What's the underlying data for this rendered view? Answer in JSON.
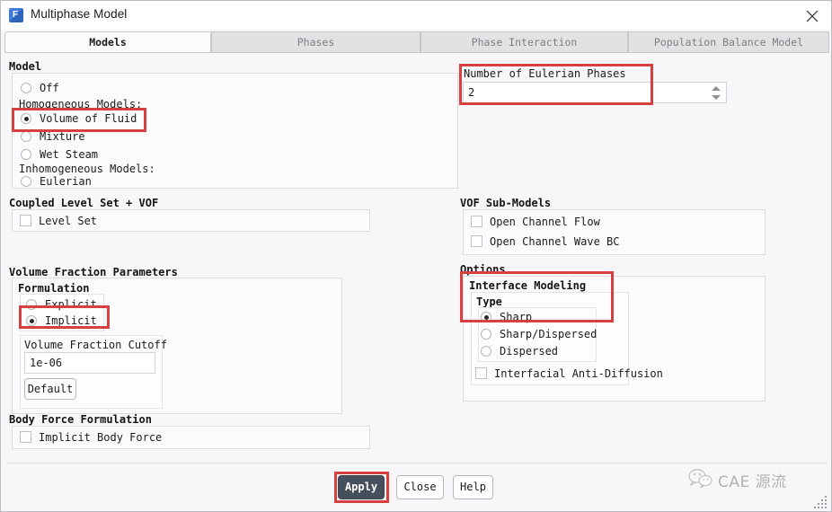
{
  "window": {
    "title": "Multiphase Model",
    "app_icon": "fluent-f-icon",
    "close_icon": "close-icon"
  },
  "tabs": [
    {
      "label": "Models",
      "active": true
    },
    {
      "label": "Phases",
      "active": false
    },
    {
      "label": "Phase Interaction",
      "active": false
    },
    {
      "label": "Population Balance Model",
      "active": false
    }
  ],
  "model_group": {
    "title": "Model",
    "off": "Off",
    "homogeneous_header": "Homogeneous Models:",
    "volume_of_fluid": "Volume of Fluid",
    "mixture": "Mixture",
    "wet_steam": "Wet Steam",
    "inhomogeneous_header": "Inhomogeneous Models:",
    "eulerian": "Eulerian",
    "selected": "Volume of Fluid"
  },
  "eulerian_phases": {
    "title": "Number of Eulerian Phases",
    "value": "2"
  },
  "level_set_group": {
    "title": "Coupled Level Set + VOF",
    "level_set": "Level Set",
    "level_set_checked": false
  },
  "vof_sub_models": {
    "title": "VOF Sub-Models",
    "open_channel_flow": "Open Channel Flow",
    "open_channel_flow_checked": false,
    "open_channel_wave_bc": "Open Channel Wave BC",
    "open_channel_wave_bc_checked": false
  },
  "volume_fraction": {
    "title": "Volume Fraction Parameters",
    "formulation_title": "Formulation",
    "explicit": "Explicit",
    "implicit": "Implicit",
    "selected": "Implicit",
    "cutoff_label": "Volume Fraction Cutoff",
    "cutoff_value": "1e-06",
    "default_button": "Default"
  },
  "options": {
    "title": "Options",
    "interface_modeling_title": "Interface Modeling",
    "type_title": "Type",
    "sharp": "Sharp",
    "sharp_dispersed": "Sharp/Dispersed",
    "dispersed": "Dispersed",
    "selected_type": "Sharp",
    "anti_diffusion": "Interfacial Anti-Diffusion",
    "anti_diffusion_checked": false
  },
  "body_force": {
    "title": "Body Force Formulation",
    "implicit_body_force": "Implicit Body Force",
    "implicit_body_force_checked": false
  },
  "footer": {
    "apply": "Apply",
    "close": "Close",
    "help": "Help"
  },
  "watermark": {
    "text": "CAE 源流",
    "icon": "wechat-icon"
  },
  "colors": {
    "annotation": "#d6403f",
    "primary_button": "#46505c",
    "panel_bg": "#fbfbfd",
    "window_bg": "#f7f7f9"
  }
}
